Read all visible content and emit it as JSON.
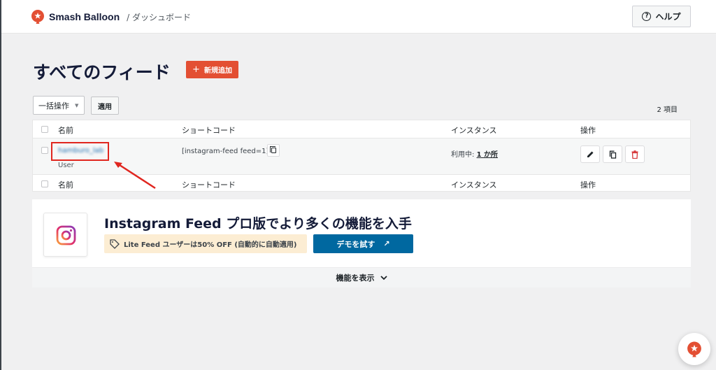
{
  "header": {
    "brand_name": "Smash Balloon",
    "breadcrumb": "/ ダッシュボード",
    "help_label": "ヘルプ",
    "help_icon": "question-circle-icon"
  },
  "page": {
    "title": "すべてのフィード",
    "add_new_label": "新規追加"
  },
  "bulk": {
    "select_value": "一括操作",
    "apply_label": "適用",
    "items_count": "2 項目"
  },
  "table": {
    "columns": [
      "名前",
      "ショートコード",
      "インスタンス",
      "操作"
    ],
    "rows": [
      {
        "name": "hamburo_lab",
        "type": "User",
        "shortcode": "[instagram-feed feed=1]",
        "instance_prefix": "利用中: ",
        "instance_link": "1 か所"
      }
    ]
  },
  "promo": {
    "title": "Instagram Feed プロ版でより多くの機能を入手",
    "discount": "Lite Feed ユーザーは50% OFF (自動的に自動適用)",
    "demo_label": "デモを試す",
    "show_features": "機能を表示"
  },
  "colors": {
    "accent_red": "#e34f33",
    "demo_blue": "#0068a0",
    "highlight_red": "#e0261f",
    "discount_bg": "#fcedd3"
  }
}
